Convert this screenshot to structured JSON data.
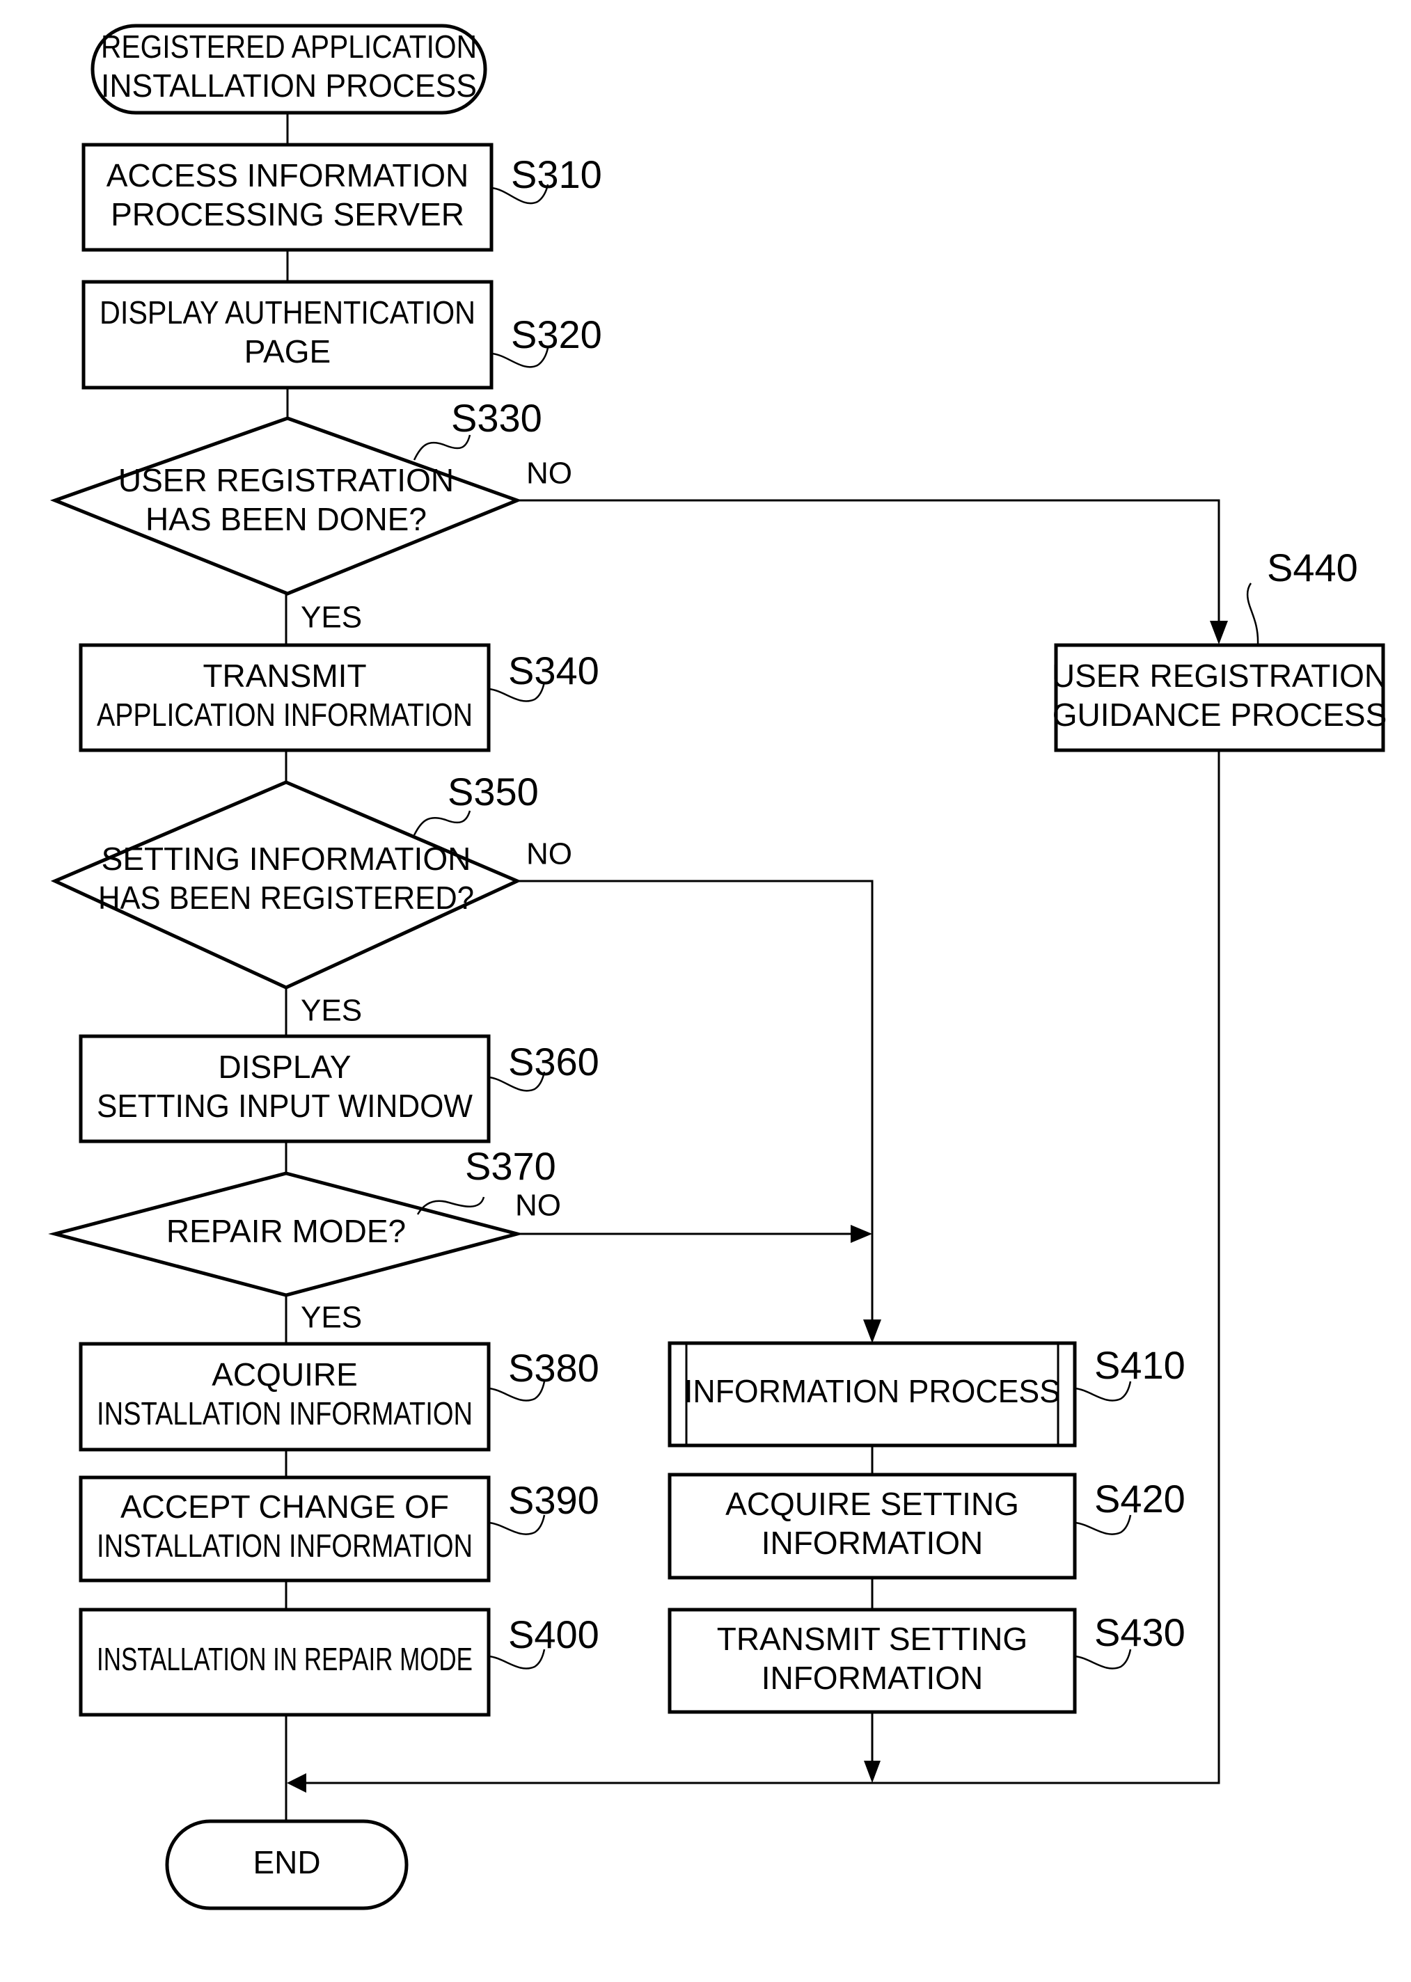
{
  "flowchart": {
    "start": {
      "lines": [
        "REGISTERED APPLICATION",
        "INSTALLATION PROCESS"
      ]
    },
    "end": {
      "lines": [
        "END"
      ]
    },
    "steps": {
      "S310": {
        "id": "S310",
        "lines": [
          "ACCESS INFORMATION",
          "PROCESSING SERVER"
        ]
      },
      "S320": {
        "id": "S320",
        "lines": [
          "DISPLAY AUTHENTICATION",
          "PAGE"
        ]
      },
      "S330": {
        "id": "S330",
        "lines": [
          "USER REGISTRATION",
          "HAS BEEN DONE?"
        ]
      },
      "S340": {
        "id": "S340",
        "lines": [
          "TRANSMIT",
          "APPLICATION INFORMATION"
        ]
      },
      "S350": {
        "id": "S350",
        "lines": [
          "SETTING INFORMATION",
          "HAS BEEN REGISTERED?"
        ]
      },
      "S360": {
        "id": "S360",
        "lines": [
          "DISPLAY",
          "SETTING INPUT WINDOW"
        ]
      },
      "S370": {
        "id": "S370",
        "lines": [
          "REPAIR MODE?"
        ]
      },
      "S380": {
        "id": "S380",
        "lines": [
          "ACQUIRE",
          "INSTALLATION INFORMATION"
        ]
      },
      "S390": {
        "id": "S390",
        "lines": [
          "ACCEPT CHANGE OF",
          "INSTALLATION INFORMATION"
        ]
      },
      "S400": {
        "id": "S400",
        "lines": [
          "INSTALLATION IN REPAIR MODE"
        ]
      },
      "S410": {
        "id": "S410",
        "lines": [
          "INFORMATION PROCESS"
        ]
      },
      "S420": {
        "id": "S420",
        "lines": [
          "ACQUIRE SETTING",
          "INFORMATION"
        ]
      },
      "S430": {
        "id": "S430",
        "lines": [
          "TRANSMIT SETTING",
          "INFORMATION"
        ]
      },
      "S440": {
        "id": "S440",
        "lines": [
          "USER REGISTRATION",
          "GUIDANCE PROCESS"
        ]
      }
    },
    "branch_labels": {
      "yes": "YES",
      "no": "NO"
    }
  }
}
